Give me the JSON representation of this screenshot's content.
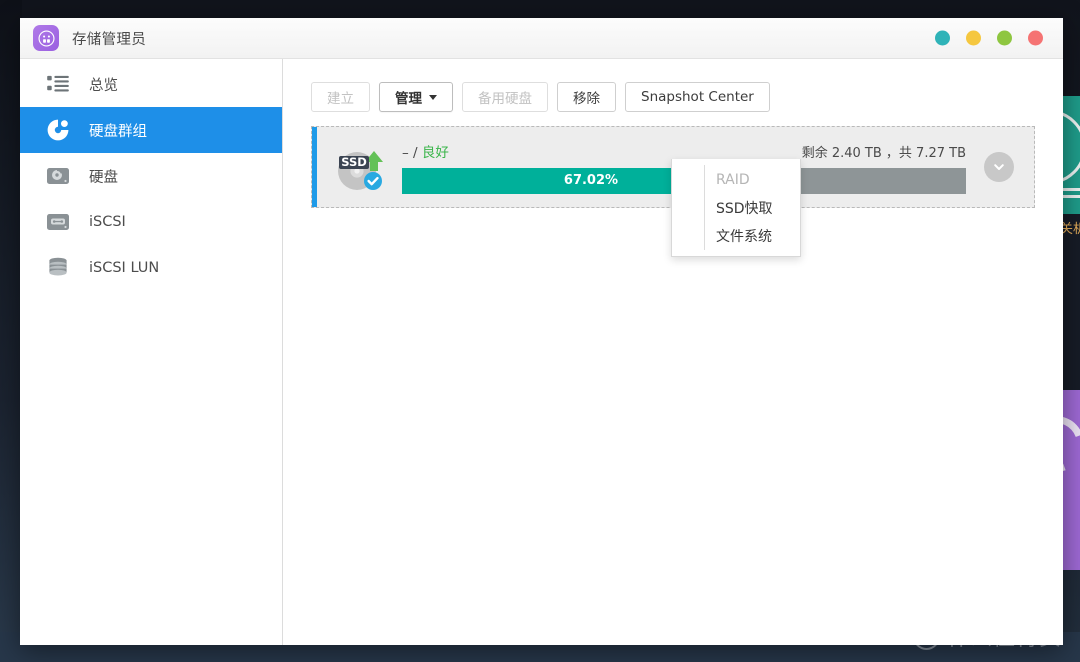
{
  "window": {
    "title": "存储管理员",
    "app_icon": "storage-manager-icon",
    "accent_purple": "#9a5fe0",
    "buttons": [
      {
        "name": "window-button-teal",
        "color": "#2fb3b8"
      },
      {
        "name": "window-button-yellow",
        "color": "#f5c73f"
      },
      {
        "name": "window-button-green",
        "color": "#8ec640"
      },
      {
        "name": "window-button-red",
        "color": "#f57373"
      }
    ]
  },
  "sidebar": {
    "items": [
      {
        "label": "总览",
        "icon": "list-overview-icon",
        "selected": false
      },
      {
        "label": "硬盘群组",
        "icon": "disk-group-icon",
        "selected": true
      },
      {
        "label": "硬盘",
        "icon": "hard-disk-icon",
        "selected": false
      },
      {
        "label": "iSCSI",
        "icon": "iscsi-icon",
        "selected": false
      },
      {
        "label": "iSCSI LUN",
        "icon": "iscsi-lun-icon",
        "selected": false
      }
    ],
    "selected_color": "#1e8fe8"
  },
  "toolbar": {
    "create_label": "建立",
    "manage_label": "管理",
    "spare_disk_label": "备用硬盘",
    "remove_label": "移除",
    "snapshot_center_label": "Snapshot Center"
  },
  "dropdown": {
    "open": true,
    "items": [
      {
        "label": "RAID",
        "disabled": true
      },
      {
        "label": "SSD快取",
        "disabled": false
      },
      {
        "label": "文件系统",
        "disabled": false
      }
    ]
  },
  "pool_card": {
    "icon": "ssd-disk-icon",
    "ssd_badge": "SSD",
    "name_text": "– /",
    "status_text": "良好",
    "status_color": "#3ab54a",
    "capacity_text": "剩余 2.40 TB ，共 7.27 TB",
    "usage_percent_label": "67.02%",
    "usage_percent_value": 67.02,
    "bar_fill_color": "#00b09a",
    "bar_track_color": "#8e9597",
    "accent_color": "#1e9ae8",
    "expand_icon": "chevron-down-icon"
  },
  "watermark": {
    "badge": "值",
    "text": "什么值得买"
  },
  "background": {
    "right_edge_dark_text": "关机"
  }
}
